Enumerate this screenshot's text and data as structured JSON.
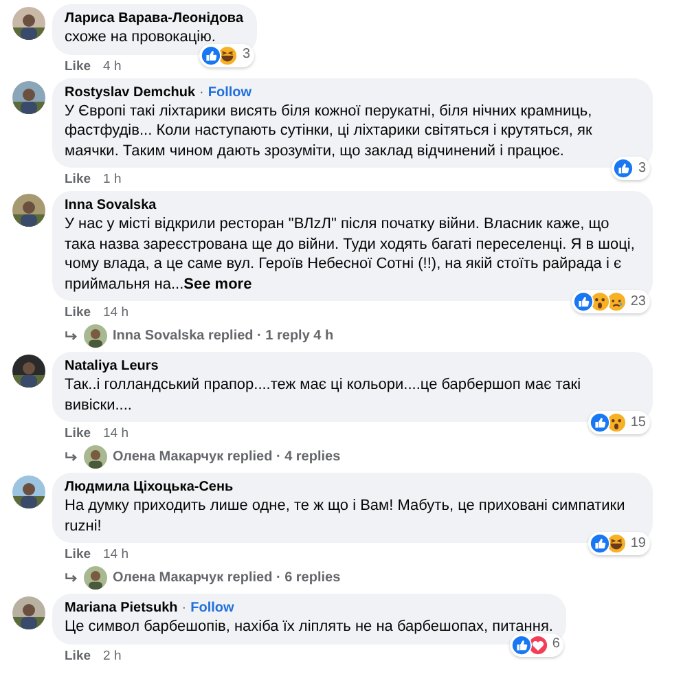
{
  "comments": [
    {
      "author": "Лариса Варава-Леонідова",
      "text": "схоже на провокацію.",
      "reactions": [
        {
          "kind": "like"
        },
        {
          "kind": "haha"
        }
      ],
      "reaction_count": "3",
      "like": "Like",
      "time": "4 h"
    },
    {
      "author": "Rostyslav Demchuk",
      "separator": "·",
      "follow": "Follow",
      "text": "У Європі такі ліхтарики висять біля кожної перукатні, біля нічних крамниць, фастфудів... Коли наступають сутінки, ці ліхтарики світяться і крутяться, як маячки. Таким чином дають зрозуміти, що заклад відчинений і працює.",
      "reactions": [
        {
          "kind": "like"
        }
      ],
      "reaction_count": "3",
      "like": "Like",
      "time": "1 h"
    },
    {
      "author": "Inna Sovalska",
      "text": "У нас у місті відкрили ресторан \"ВЛzЛ\" після початку війни. Власник каже, що така назва зареєстрована ще до війни. Туди ходять багаті переселенці. Я в шоці, чому влада, а це саме вул. Героїв Небесної Сотні (!!), на якій стоїть райрада і є приймальня на...",
      "see_more": "See more",
      "reactions": [
        {
          "kind": "like"
        },
        {
          "kind": "wow"
        },
        {
          "kind": "sad"
        }
      ],
      "reaction_count": "23",
      "like": "Like",
      "time": "14 h",
      "replies": "Inna Sovalska replied · 1 reply 4 h"
    },
    {
      "author": "Nataliya Leurs",
      "text": "Так..і голландський прапор....теж має ці кольори....це барбершоп має такі вивіски....",
      "reactions": [
        {
          "kind": "like"
        },
        {
          "kind": "wow"
        }
      ],
      "reaction_count": "15",
      "like": "Like",
      "time": "14 h",
      "replies": "Олена Макарчук replied · 4 replies"
    },
    {
      "author": "Людмила Ціхоцька-Сень",
      "text": "На думку приходить лише одне, те ж що і Вам! Мабуть, це приховані симпатики ruzні!",
      "reactions": [
        {
          "kind": "like"
        },
        {
          "kind": "haha"
        }
      ],
      "reaction_count": "19",
      "like": "Like",
      "time": "14 h",
      "replies": "Олена Макарчук replied · 6 replies"
    },
    {
      "author": "Mariana Pietsukh",
      "separator": "·",
      "follow": "Follow",
      "text": "Це символ барбешопів, нахіба їх ліплять не на барбешопах, питання.",
      "reactions": [
        {
          "kind": "like"
        },
        {
          "kind": "love"
        }
      ],
      "reaction_count": "6",
      "like": "Like",
      "time": "2 h"
    }
  ]
}
